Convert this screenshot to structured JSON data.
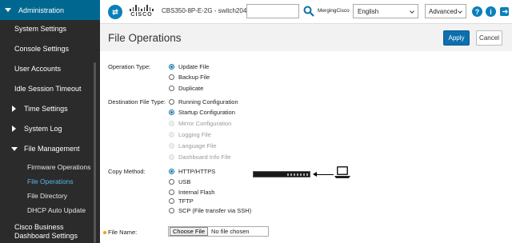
{
  "sidebar": {
    "header": "Administration",
    "items": [
      {
        "label": "System Settings"
      },
      {
        "label": "Console Settings"
      },
      {
        "label": "User Accounts"
      },
      {
        "label": "Idle Session Timeout"
      },
      {
        "label": "Time Settings"
      },
      {
        "label": "System Log"
      },
      {
        "label": "File Management"
      }
    ],
    "sub_items": [
      {
        "label": "Firmware Operations"
      },
      {
        "label": "File Operations"
      },
      {
        "label": "File Directory"
      },
      {
        "label": "DHCP Auto Update"
      }
    ],
    "footer_line1": "Cisco Business",
    "footer_line2": "Dashboard Settings"
  },
  "topbar": {
    "device": "CBS350-8P-E-2G - switch204",
    "user": "MergingCisco",
    "language": "English",
    "mode": "Advanced",
    "cisco_logo_text": "CISCO"
  },
  "page": {
    "title": "File Operations",
    "apply_label": "Apply",
    "cancel_label": "Cancel"
  },
  "form": {
    "operation_type_label": "Operation Type:",
    "operation_types": [
      "Update File",
      "Backup File",
      "Duplicate"
    ],
    "operation_selected": "Update File",
    "destination_label": "Destination File Type:",
    "destinations": [
      "Running Configuration",
      "Startup Configuration",
      "Mirror Configuration",
      "Logging File",
      "Language File",
      "Dashboard Info File"
    ],
    "destination_selected": "Startup Configuration",
    "copy_method_label": "Copy Method:",
    "copy_methods": [
      "HTTP/HTTPS",
      "USB",
      "Internal Flash",
      "TFTP",
      "SCP (File transfer via SSH)"
    ],
    "copy_method_selected": "HTTP/HTTPS",
    "file_name_label": "File Name:",
    "choose_file_label": "Choose File",
    "no_file_text": "No file chosen"
  },
  "colors": {
    "sidebar_bg": "#2b2b2b",
    "sidebar_header": "#006890",
    "accent": "#0d6fad",
    "active_link": "#58b7e6"
  }
}
